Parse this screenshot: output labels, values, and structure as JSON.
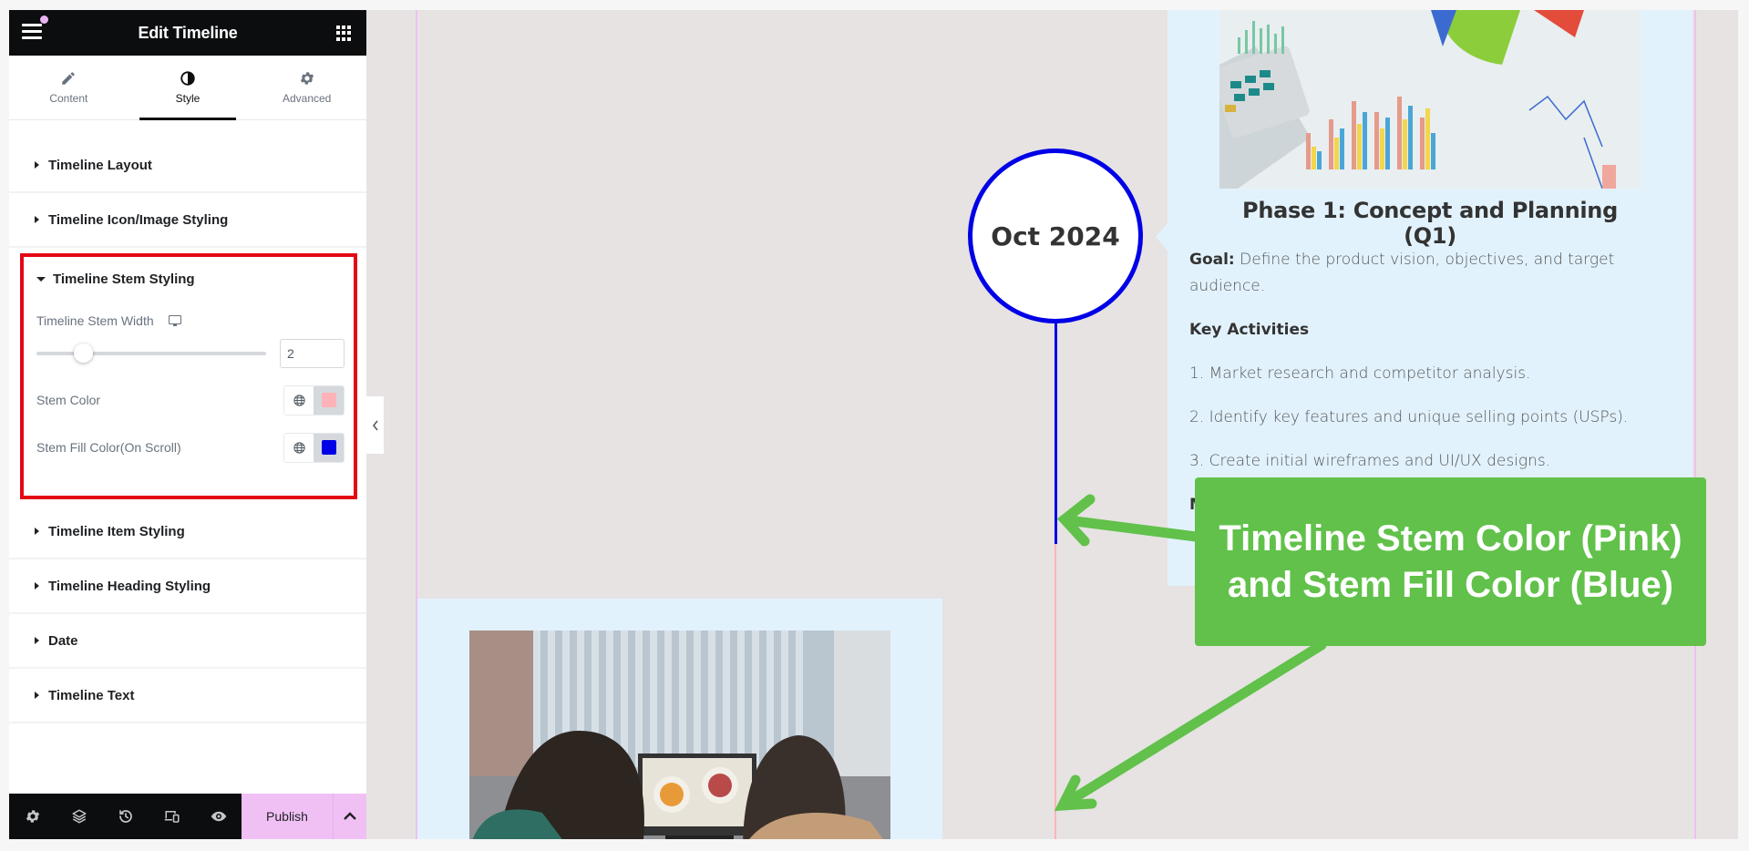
{
  "panel": {
    "title": "Edit Timeline",
    "tabs": [
      {
        "label": "Content",
        "icon": "pencil-icon",
        "active": false
      },
      {
        "label": "Style",
        "icon": "contrast-icon",
        "active": true
      },
      {
        "label": "Advanced",
        "icon": "gear-icon",
        "active": false
      }
    ],
    "sections_before": [
      {
        "label": "Timeline Layout"
      },
      {
        "label": "Timeline Icon/Image Styling"
      }
    ],
    "stem_section": {
      "label": "Timeline Stem Styling",
      "width_label": "Timeline Stem Width",
      "width_value": "2",
      "width_fraction": 0.2,
      "stem_color_label": "Stem Color",
      "stem_color": "#ffb3b8",
      "fill_color_label": "Stem Fill Color(On Scroll)",
      "fill_color": "#0000e6"
    },
    "sections_after": [
      {
        "label": "Timeline Item Styling"
      },
      {
        "label": "Timeline Heading Styling"
      },
      {
        "label": "Date"
      },
      {
        "label": "Timeline Text"
      }
    ],
    "bottom_bar": {
      "icons": [
        "settings-icon",
        "layers-icon",
        "history-icon",
        "responsive-icon",
        "preview-eye-icon"
      ],
      "publish_label": "Publish"
    }
  },
  "canvas": {
    "date": "Oct 2024",
    "stem_fill_progress": 0.77,
    "phase": {
      "title": "Phase 1: Concept and Planning (Q1)",
      "goal_label": "Goal:",
      "goal_text": " Define the product vision, objectives, and target audience.",
      "key_activities_label": "Key Activities",
      "activities": [
        "1. Market research and competitor analysis.",
        "2. Identify key features and unique selling points (USPs).",
        "3. Create initial wireframes and UI/UX designs."
      ],
      "next_heading_partial": "M"
    },
    "images": {
      "top": "financial charts with calculator",
      "bottom": "two people looking at a monitor showing food photos"
    }
  },
  "annotation": {
    "text": "Timeline Stem Color (Pink) and Stem Fill Color (Blue)",
    "color": "#61c14a"
  },
  "colors": {
    "highlight_border": "#e30613",
    "publish_bg": "#f0c0f5",
    "canvas_bg": "#e6e3e2",
    "card_bg": "#e2f2fd"
  }
}
